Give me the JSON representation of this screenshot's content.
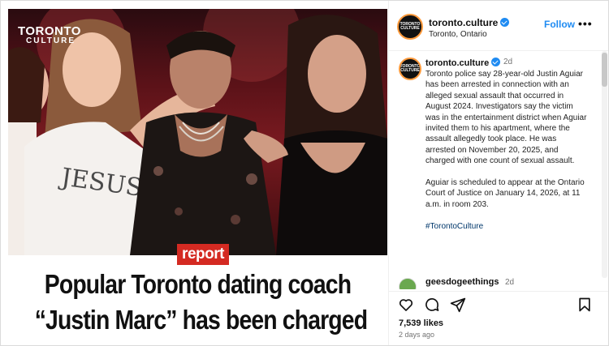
{
  "media": {
    "watermark_line1": "TORONTO",
    "watermark_line2": "CULTURE",
    "shirt_print": "JESUS SAVES",
    "badge": "report",
    "headline_line1": "Popular Toronto dating coach",
    "headline_line2": "“Justin Marc” has been charged"
  },
  "header": {
    "account": "toronto.culture",
    "location": "Toronto, Ontario",
    "follow_label": "Follow",
    "more_label": "•••",
    "avatar_text": "TORONTO CULTURE"
  },
  "caption": {
    "account": "toronto.culture",
    "time": "2d",
    "paragraph1": "Toronto police say 28-year-old Justin Aguiar has been arrested in connection with an alleged sexual assault that occurred in August 2024. Investigators say the victim was in the entertainment district when Aguiar invited them to his apartment, where the assault allegedly took place. He was arrested on November 20, 2025, and charged with one count of sexual assault.",
    "paragraph2": "Aguiar is scheduled to appear at the Ontario Court of Justice on January 14, 2026, at 11 a.m. in room 203.",
    "hashtag": "#TorontoCulture"
  },
  "comment": {
    "user": "geesdogeethings",
    "time": "2d"
  },
  "engagement": {
    "likes": "7,539 likes",
    "posted": "2 days ago"
  },
  "icons": [
    "heart-icon",
    "comment-icon",
    "share-icon",
    "bookmark-icon",
    "verified-badge-icon",
    "more-options-icon"
  ],
  "colors": {
    "accent": "#1f8bf2",
    "report_badge": "#d42a22",
    "hashtag": "#00376b",
    "muted_text": "#737373"
  }
}
